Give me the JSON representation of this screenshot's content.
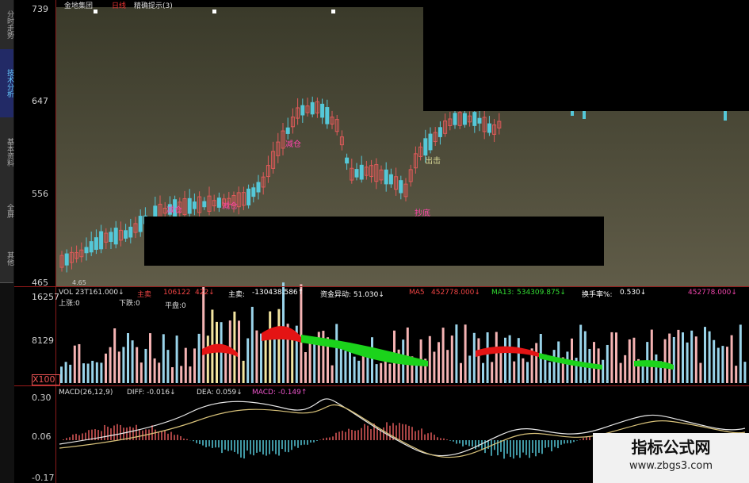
{
  "header": {
    "stock_name": "金地集团",
    "period": "日线",
    "indicator": "精确提示(3)"
  },
  "side_tabs": [
    {
      "label": "分时走势",
      "active": false
    },
    {
      "label": "技术分析",
      "active": true
    },
    {
      "label": "基本资料",
      "active": false
    },
    {
      "label": "全屏",
      "active": false
    },
    {
      "label": "其他",
      "active": false
    }
  ],
  "price_axis": [
    "739",
    "647",
    "556",
    "465"
  ],
  "low_marker": "4.65",
  "signals": {
    "reduce1": "减仓",
    "reduce2": "减仓",
    "reduce3": "减仓",
    "exit": "出击",
    "buy": "抄底"
  },
  "vol_line": {
    "vol": "VOL 23T161.000↓",
    "main_sell": "主卖",
    "v1": "106122",
    "v2": "422↓",
    "main": "主卖:",
    "main_val": "-130438.586↑",
    "fund": "资金异动: 51.030↓",
    "ma5": "MA5",
    "ma5_val": "452778.000↓",
    "ma13": "MA13:",
    "ma13_val": "534309.875↓",
    "turnover": "换手率%:",
    "turnover_val": "0.530↓",
    "extra": "452778.000↓"
  },
  "counts": {
    "up": "上涨:0",
    "down": "下跌:0",
    "flat": "平盘:0"
  },
  "vol_axis": [
    "16257",
    "8129",
    "X100"
  ],
  "macd_line": {
    "params": "MACD(26,12,9)",
    "diff": "DIFF: -0.016↓",
    "dea": "DEA: 0.059↓",
    "macd": "MACD: -0.149↑"
  },
  "macd_axis": [
    "0.30",
    "0.06",
    "-0.17"
  ],
  "watermark": {
    "title": "指标公式网",
    "url": "www.zbgs3.com"
  },
  "colors": {
    "up": "#e05a5a",
    "down": "#55c8d8",
    "panel_border": "#9a1a1a",
    "diff": "#e8e8e8",
    "dea": "#d8c27a"
  }
}
